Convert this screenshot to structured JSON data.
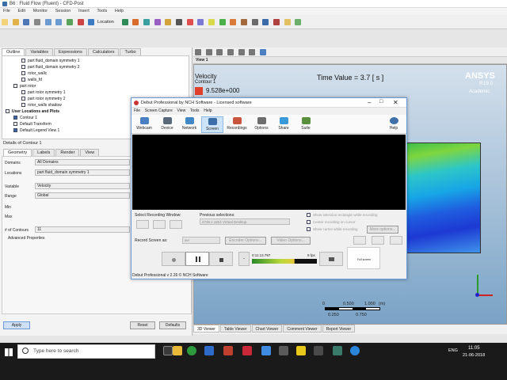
{
  "cfd": {
    "title": "B6 : Fluid Flow (Fluent) - CFD-Post",
    "menus": [
      "File",
      "Edit",
      "Monitor",
      "Session",
      "Insert",
      "Tools",
      "Help"
    ],
    "location_label": "Location",
    "left_tabs": [
      "Outline",
      "Variables",
      "Expressions",
      "Calculators",
      "Turbo"
    ],
    "tree": [
      {
        "label": "part fluid_domain symmetry 1",
        "checked": false,
        "indent": 2
      },
      {
        "label": "part fluid_domain symmetry 2",
        "checked": false,
        "indent": 2
      },
      {
        "label": "rotor_wallc",
        "checked": false,
        "indent": 2
      },
      {
        "label": "walls_fd",
        "checked": false,
        "indent": 2
      },
      {
        "label": "part rotor",
        "checked": false,
        "indent": 1
      },
      {
        "label": "part rotor symmetry 1",
        "checked": false,
        "indent": 2
      },
      {
        "label": "part rotor symmetry 2",
        "checked": false,
        "indent": 2
      },
      {
        "label": "rotor_walls shadow",
        "checked": false,
        "indent": 2
      },
      {
        "label": "User Locations and Plots",
        "checked": false,
        "indent": 0,
        "bold": true
      },
      {
        "label": "Contour 1",
        "checked": true,
        "indent": 1
      },
      {
        "label": "Default Transform",
        "checked": false,
        "indent": 1
      },
      {
        "label": "Default Legend View 1",
        "checked": true,
        "indent": 1
      }
    ],
    "details_title": "Details of Contour 1",
    "detail_tabs": [
      "Geometry",
      "Labels",
      "Render",
      "View"
    ],
    "form": {
      "domains_label": "Domains",
      "domains_value": "All Domains",
      "locations_label": "Locations",
      "locations_value": "part fluid_domain symmetry 1",
      "variable_label": "Variable",
      "variable_value": "Velocity",
      "range_label": "Range",
      "range_value": "Global",
      "min_label": "Min",
      "max_label": "Max",
      "contours_label": "# of Contours",
      "contours_value": "11",
      "advanced_label": "Advanced Properties"
    },
    "apply_label": "Apply",
    "reset_label": "Reset",
    "defaults_label": "Defaults",
    "viewer_label": "View 1",
    "legend_title": "Velocity",
    "legend_sub": "Contour 1",
    "legend_max": "9.528e+000",
    "time_value": "Time Value = 3.7 [ s ]",
    "brand": "ANSYS",
    "brand_version": "R19.0",
    "brand_edition": "Academic",
    "scale": {
      "t0": "0",
      "t1": "0.500",
      "t2": "1.000",
      "unit": "(m)",
      "b1": "0.250",
      "b2": "0.750"
    },
    "viewer_tabs": [
      "3D Viewer",
      "Table Viewer",
      "Chart Viewer",
      "Comment Viewer",
      "Report Viewer"
    ]
  },
  "debut": {
    "title": "Debut Professional by NCH Software - Licensed software",
    "menus": [
      "File",
      "Screen Capture",
      "View",
      "Tools",
      "Help"
    ],
    "tools": [
      {
        "label": "Webcam",
        "icon": "webcam-icon",
        "color": "#4a7fc1"
      },
      {
        "label": "Device",
        "icon": "device-icon",
        "color": "#5b6a7a"
      },
      {
        "label": "Network",
        "icon": "network-icon",
        "color": "#3f88c5"
      },
      {
        "label": "Screen",
        "icon": "screen-icon",
        "color": "#3b6ea8"
      },
      {
        "label": "Recordings",
        "icon": "recordings-icon",
        "color": "#c8553d"
      },
      {
        "label": "Options",
        "icon": "options-icon",
        "color": "#6d6d6d"
      },
      {
        "label": "Share",
        "icon": "share-icon",
        "color": "#3a9ad9"
      },
      {
        "label": "Suite",
        "icon": "suite-icon",
        "color": "#5a8f3d"
      },
      {
        "label": "Help",
        "icon": "help-icon",
        "color": "#3f6fa8"
      }
    ],
    "select_window_label": "Select Recording Window:",
    "previous_selections_label": "Previous selections:",
    "previous_value": "2736 x 1824 Virtual Desktop",
    "opt1": "Show selection rectangle while recording",
    "opt2": "Center recording on cursor",
    "opt3": "Show cursor while recording",
    "more_options": "More options...",
    "record_as_label": "Record Screen as:",
    "format_value": "avi",
    "encoder_options": "Encoder Options...",
    "video_options": "Video Options...",
    "timer": "0:11:13.797",
    "fps": "9 fps",
    "fullscreen": "Full screen",
    "status": "Debut Professional v 2.26 © NCH Software"
  },
  "taskbar": {
    "search_placeholder": "Type here to search",
    "time": "11:05",
    "date": "21-06-2018",
    "lang": "ENG"
  }
}
